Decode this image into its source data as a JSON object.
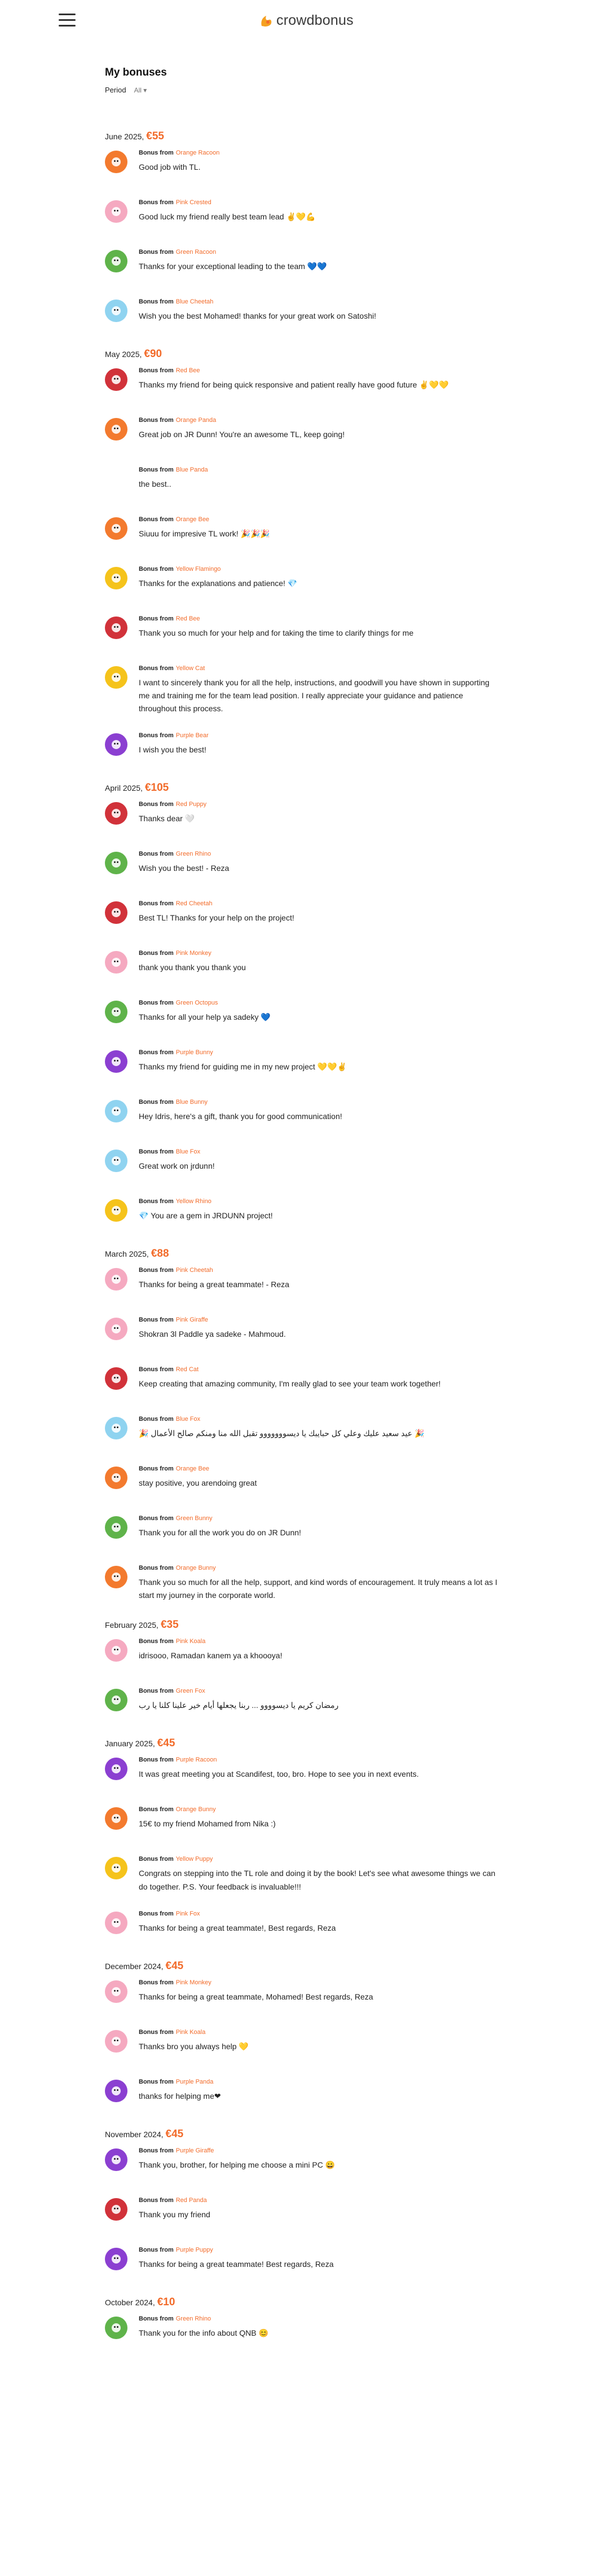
{
  "header": {
    "logo_text": "crowdbonus"
  },
  "page": {
    "title": "My bonuses",
    "period_label": "Period",
    "period_value": "All ▾",
    "bonus_from_label": "Bonus from"
  },
  "months": [
    {
      "label": "June 2025,",
      "amount": "€55",
      "bonuses": [
        {
          "from": "Orange Racoon",
          "color": "#f37a2e",
          "message": "Good job with TL."
        },
        {
          "from": "Pink Crested",
          "color": "#f5a9c0",
          "message": "Good luck my friend really best team lead ✌️💛💪"
        },
        {
          "from": "Green Racoon",
          "color": "#5fb34a",
          "message": "Thanks for your exceptional leading to the team 💙💙"
        },
        {
          "from": "Blue Cheetah",
          "color": "#8fd3f0",
          "message": "Wish you the best Mohamed! thanks for your great work on Satoshi!"
        }
      ]
    },
    {
      "label": "May 2025,",
      "amount": "€90",
      "bonuses": [
        {
          "from": "Red Bee",
          "color": "#d1323a",
          "message": "Thanks my friend for being quick responsive and patient really have good future ✌️💛💛"
        },
        {
          "from": "Orange Panda",
          "color": "#f37a2e",
          "message": "Great job on JR Dunn! You're an awesome TL, keep going!"
        },
        {
          "from": "Blue Panda",
          "color": "",
          "message": "the best.."
        },
        {
          "from": "Orange Bee",
          "color": "#f37a2e",
          "message": "Siuuu for impresive TL work! 🎉🎉🎉"
        },
        {
          "from": "Yellow Flamingo",
          "color": "#f5c31b",
          "message": "Thanks for the explanations and patience! 💎"
        },
        {
          "from": "Red Bee",
          "color": "#d1323a",
          "message": "Thank you so much for your help and for taking the time to clarify things for me"
        },
        {
          "from": "Yellow Cat",
          "color": "#f5c31b",
          "message": "I want to sincerely thank you for all the help, instructions, and goodwill you have shown in supporting me and training me for the team lead position. I really appreciate your guidance and patience throughout this process."
        },
        {
          "from": "Purple Bear",
          "color": "#8b3fd1",
          "message": "I wish you the best!"
        }
      ]
    },
    {
      "label": "April 2025,",
      "amount": "€105",
      "bonuses": [
        {
          "from": "Red Puppy",
          "color": "#d1323a",
          "message": "Thanks dear 🤍"
        },
        {
          "from": "Green Rhino",
          "color": "#5fb34a",
          "message": "Wish you the best! - Reza"
        },
        {
          "from": "Red Cheetah",
          "color": "#d1323a",
          "message": "Best TL! Thanks for your help on the project!"
        },
        {
          "from": "Pink Monkey",
          "color": "#f5a9c0",
          "message": "thank you thank you thank you"
        },
        {
          "from": "Green Octopus",
          "color": "#5fb34a",
          "message": "Thanks for all your help ya sadeky 💙"
        },
        {
          "from": "Purple Bunny",
          "color": "#8b3fd1",
          "message": "Thanks my friend for guiding me in my new project 💛💛✌️"
        },
        {
          "from": "Blue Bunny",
          "color": "#8fd3f0",
          "message": "Hey Idris, here's a gift, thank you for good communication!"
        },
        {
          "from": "Blue Fox",
          "color": "#8fd3f0",
          "message": "Great work on jrdunn!"
        },
        {
          "from": "Yellow Rhino",
          "color": "#f5c31b",
          "message": "💎 You are a gem in JRDUNN project!"
        }
      ]
    },
    {
      "label": "March 2025,",
      "amount": "€88",
      "bonuses": [
        {
          "from": "Pink Cheetah",
          "color": "#f5a9c0",
          "message": "Thanks for being a great teammate! - Reza"
        },
        {
          "from": "Pink Giraffe",
          "color": "#f5a9c0",
          "message": "Shokran 3l Paddle ya sadeke - Mahmoud."
        },
        {
          "from": "Red Cat",
          "color": "#d1323a",
          "message": "Keep creating that amazing community, I'm really glad to see your team work together!"
        },
        {
          "from": "Blue Fox",
          "color": "#8fd3f0",
          "message": "🎉 عيد سعيد عليك وعلي كل حبايبك يا ديسووووووو تقبل الله منا ومنكم صالح الأعمال 🎉"
        },
        {
          "from": "Orange Bee",
          "color": "#f37a2e",
          "message": "stay positive, you arendoing great"
        },
        {
          "from": "Green Bunny",
          "color": "#5fb34a",
          "message": "Thank you for all the work you do on JR Dunn!"
        },
        {
          "from": "Orange Bunny",
          "color": "#f37a2e",
          "message": "Thank you so much for all the help, support, and kind words of encouragement. It truly means a lot as I start my journey in the corporate world."
        }
      ]
    },
    {
      "label": "February 2025,",
      "amount": "€35",
      "bonuses": [
        {
          "from": "Pink Koala",
          "color": "#f5a9c0",
          "message": "idrisooo, Ramadan kanem ya a khoooya!"
        },
        {
          "from": "Green Fox",
          "color": "#5fb34a",
          "message": "رمضان كريم يا ديسوووو ... ربنا يجعلها أيام خير علينا كلنا يا رب"
        }
      ]
    },
    {
      "label": "January 2025,",
      "amount": "€45",
      "bonuses": [
        {
          "from": "Purple Racoon",
          "color": "#8b3fd1",
          "message": "It was great meeting you at Scandifest, too, bro. Hope to see you in next events."
        },
        {
          "from": "Orange Bunny",
          "color": "#f37a2e",
          "message": "15€ to my friend Mohamed from Nika :)"
        },
        {
          "from": "Yellow Puppy",
          "color": "#f5c31b",
          "message": "Congrats on stepping into the TL role and doing it by the book! Let's see what awesome things we can do together. P.S. Your feedback is invaluable!!!"
        },
        {
          "from": "Pink Fox",
          "color": "#f5a9c0",
          "message": "Thanks for being a great teammate!, Best regards, Reza"
        }
      ]
    },
    {
      "label": "December 2024,",
      "amount": "€45",
      "bonuses": [
        {
          "from": "Pink Monkey",
          "color": "#f5a9c0",
          "message": "Thanks for being a great teammate, Mohamed! Best regards, Reza"
        },
        {
          "from": "Pink Koala",
          "color": "#f5a9c0",
          "message": "Thanks bro you always help 💛"
        },
        {
          "from": "Purple Panda",
          "color": "#8b3fd1",
          "message": "thanks for helping me❤"
        }
      ]
    },
    {
      "label": "November 2024,",
      "amount": "€45",
      "bonuses": [
        {
          "from": "Purple Giraffe",
          "color": "#8b3fd1",
          "message": "Thank you, brother, for helping me choose a mini PC 😀"
        },
        {
          "from": "Red Panda",
          "color": "#d1323a",
          "message": "Thank you my friend"
        },
        {
          "from": "Purple Puppy",
          "color": "#8b3fd1",
          "message": "Thanks for being a great teammate! Best regards, Reza"
        }
      ]
    },
    {
      "label": "October 2024,",
      "amount": "€10",
      "bonuses": [
        {
          "from": "Green Rhino",
          "color": "#5fb34a",
          "message": "Thank you for the info about QNB 😊"
        }
      ]
    }
  ]
}
